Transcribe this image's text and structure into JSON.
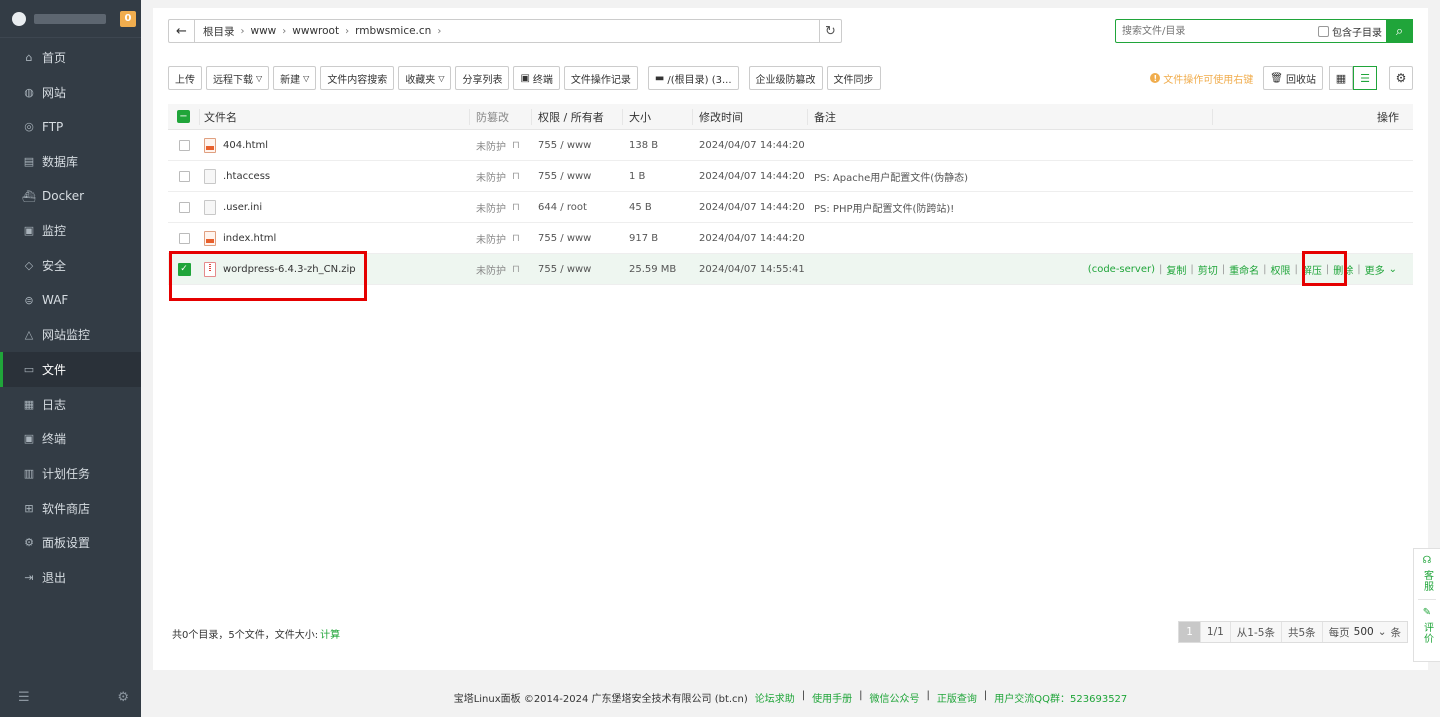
{
  "sidebar": {
    "badge": "0",
    "items": [
      {
        "label": "首页",
        "icon": "home-icon",
        "glyph": "⌂"
      },
      {
        "label": "网站",
        "icon": "globe-icon",
        "glyph": "◍"
      },
      {
        "label": "FTP",
        "icon": "ftp-icon",
        "glyph": "◎"
      },
      {
        "label": "数据库",
        "icon": "database-icon",
        "glyph": "▤"
      },
      {
        "label": "Docker",
        "icon": "docker-icon",
        "glyph": "⛴"
      },
      {
        "label": "监控",
        "icon": "monitor-icon",
        "glyph": "▣"
      },
      {
        "label": "安全",
        "icon": "shield-icon",
        "glyph": "◇"
      },
      {
        "label": "WAF",
        "icon": "waf-icon",
        "glyph": "⊜"
      },
      {
        "label": "网站监控",
        "icon": "site-monitor-icon",
        "glyph": "△"
      },
      {
        "label": "文件",
        "icon": "folder-icon",
        "glyph": "▭"
      },
      {
        "label": "日志",
        "icon": "log-icon",
        "glyph": "▦"
      },
      {
        "label": "终端",
        "icon": "terminal-icon",
        "glyph": "▣"
      },
      {
        "label": "计划任务",
        "icon": "schedule-icon",
        "glyph": "▥"
      },
      {
        "label": "软件商店",
        "icon": "store-icon",
        "glyph": "⊞"
      },
      {
        "label": "面板设置",
        "icon": "settings-icon",
        "glyph": "⚙"
      },
      {
        "label": "退出",
        "icon": "logout-icon",
        "glyph": "⇥"
      }
    ],
    "active_index": 9
  },
  "path": {
    "crumbs": [
      "根目录",
      "www",
      "wwwroot",
      "rmbwsmice.cn"
    ]
  },
  "search": {
    "placeholder": "搜索文件/目录",
    "include_sub": "包含子目录"
  },
  "toolbar": {
    "upload": "上传",
    "remote_download": "远程下载",
    "new": "新建",
    "content_search": "文件内容搜索",
    "favorites": "收藏夹",
    "share_list": "分享列表",
    "terminal": "终端",
    "op_log": "文件操作记录",
    "disk": "/(根目录) (3...",
    "tamper": "企业级防篡改",
    "sync": "文件同步",
    "hint": "文件操作可使用右键",
    "recycle": "回收站"
  },
  "table": {
    "headers": {
      "name": "文件名",
      "protect": "防篡改",
      "perm": "权限 / 所有者",
      "size": "大小",
      "mtime": "修改时间",
      "note": "备注",
      "ops": "操作"
    },
    "rows": [
      {
        "name": "404.html",
        "type": "html",
        "protect": "未防护",
        "perm": "755 / www",
        "size": "138 B",
        "mtime": "2024/04/07 14:44:20",
        "note": ""
      },
      {
        "name": ".htaccess",
        "type": "text",
        "protect": "未防护",
        "perm": "755 / www",
        "size": "1 B",
        "mtime": "2024/04/07 14:44:20",
        "note": "PS: Apache用户配置文件(伪静态)"
      },
      {
        "name": ".user.ini",
        "type": "text",
        "protect": "未防护",
        "perm": "644 / root",
        "size": "45 B",
        "mtime": "2024/04/07 14:44:20",
        "note": "PS: PHP用户配置文件(防跨站)!"
      },
      {
        "name": "index.html",
        "type": "html",
        "protect": "未防护",
        "perm": "755 / www",
        "size": "917 B",
        "mtime": "2024/04/07 14:44:20",
        "note": ""
      },
      {
        "name": "wordpress-6.4.3-zh_CN.zip",
        "type": "zip",
        "protect": "未防护",
        "perm": "755 / www",
        "size": "25.59 MB",
        "mtime": "2024/04/07 14:55:41",
        "note": ""
      }
    ],
    "selected_row_ops": [
      "(code-server)",
      "复制",
      "剪切",
      "重命名",
      "权限",
      "解压",
      "删除",
      "更多"
    ]
  },
  "summary": {
    "text": "共0个目录，5个文件，文件大小:",
    "calc": "计算"
  },
  "pager": {
    "current": "1",
    "pages": "1/1",
    "range": "从1-5条",
    "total": "共5条",
    "per_page_label": "每页",
    "per_page": "500",
    "unit": "条"
  },
  "footer": {
    "copyright": "宝塔Linux面板 ©2014-2024 广东堡塔安全技术有限公司 (bt.cn)",
    "links": [
      "论坛求助",
      "使用手册",
      "微信公众号",
      "正版查询",
      "用户交流QQ群：523693527"
    ]
  },
  "float_help": {
    "service": "客服",
    "review": "评价"
  },
  "colors": {
    "accent": "#20a53a",
    "sidebar_bg": "#333c45",
    "highlight": "#e50000",
    "warning": "#f0ad4e"
  }
}
